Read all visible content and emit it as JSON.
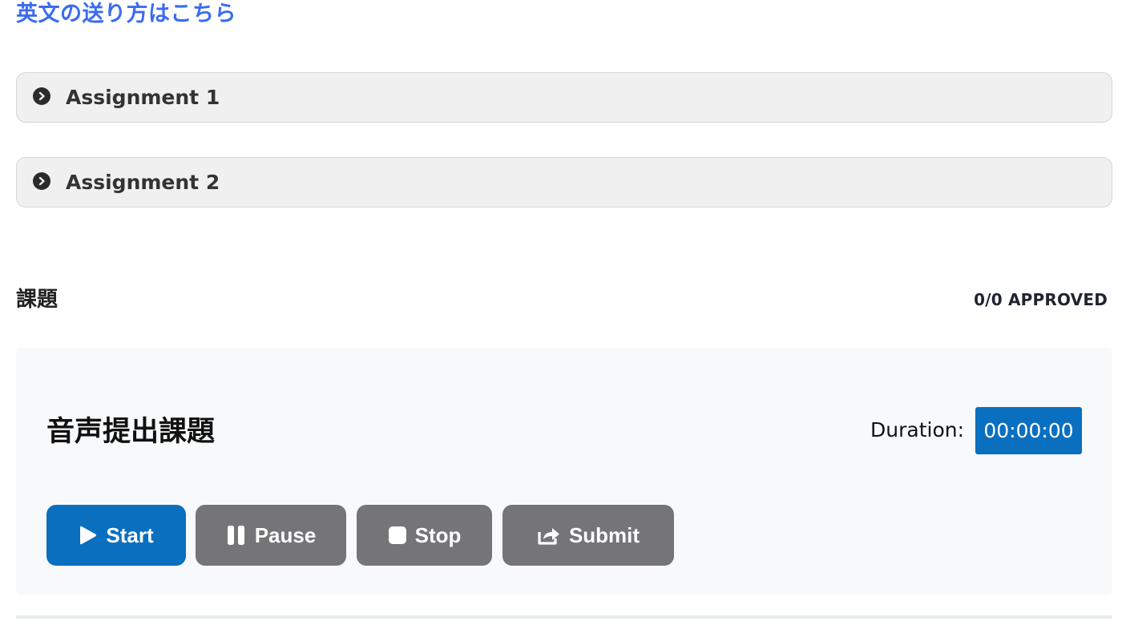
{
  "header": {
    "help_link": "英文の送り方はこちら"
  },
  "accordions": [
    {
      "label": "Assignment 1",
      "icon": "chevron-right-circle-icon"
    },
    {
      "label": "Assignment 2",
      "icon": "chevron-right-circle-icon"
    }
  ],
  "section": {
    "title": "課題",
    "approved_status": "0/0 APPROVED"
  },
  "task_card": {
    "title": "音声提出課題",
    "duration_label": "Duration:",
    "duration_value": "00:00:00",
    "buttons": {
      "start": {
        "label": "Start",
        "icon": "play-icon",
        "color": "#0a6fbf"
      },
      "pause": {
        "label": "Pause",
        "icon": "pause-icon",
        "color": "#757578"
      },
      "stop": {
        "label": "Stop",
        "icon": "stop-icon",
        "color": "#757578"
      },
      "submit": {
        "label": "Submit",
        "icon": "share-icon",
        "color": "#757578"
      }
    }
  },
  "colors": {
    "link": "#3b6cf0",
    "primary": "#0a6fbf",
    "disabled_button": "#757578"
  }
}
